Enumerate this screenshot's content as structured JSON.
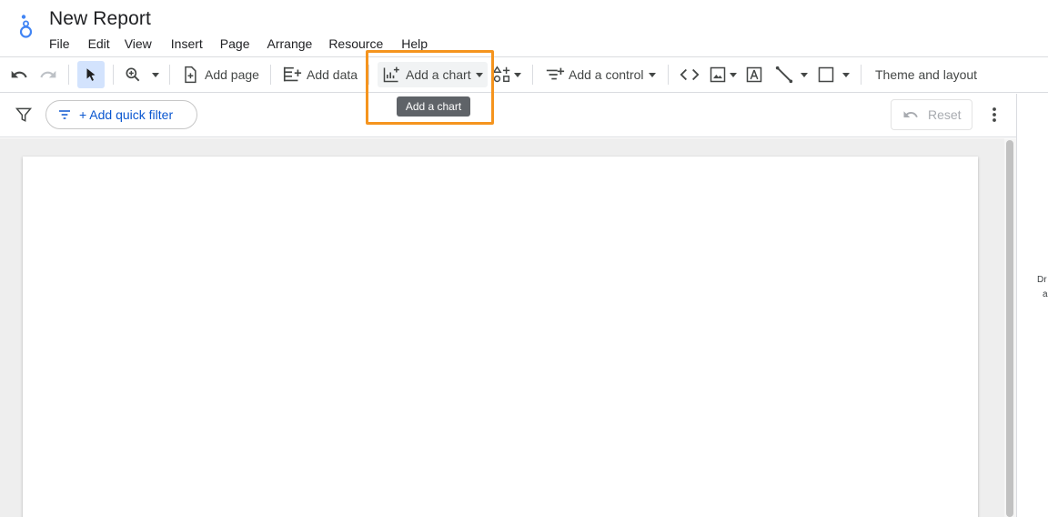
{
  "app": {
    "title": "New Report"
  },
  "menu": {
    "items": [
      "File",
      "Edit",
      "View",
      "Insert",
      "Page",
      "Arrange",
      "Resource",
      "Help"
    ]
  },
  "toolbar": {
    "add_page": "Add page",
    "add_data": "Add data",
    "add_chart": "Add a chart",
    "add_control": "Add a control",
    "theme_layout": "Theme and layout"
  },
  "tooltip": {
    "text": "Add a chart"
  },
  "filterbar": {
    "quick_filter": "+ Add quick filter",
    "reset": "Reset"
  },
  "right_panel": {
    "line1": "Dr",
    "line2": "a"
  },
  "colors": {
    "accent": "#0b57d0",
    "highlight": "#f5941e",
    "active_tool": "#d3e3fd"
  }
}
